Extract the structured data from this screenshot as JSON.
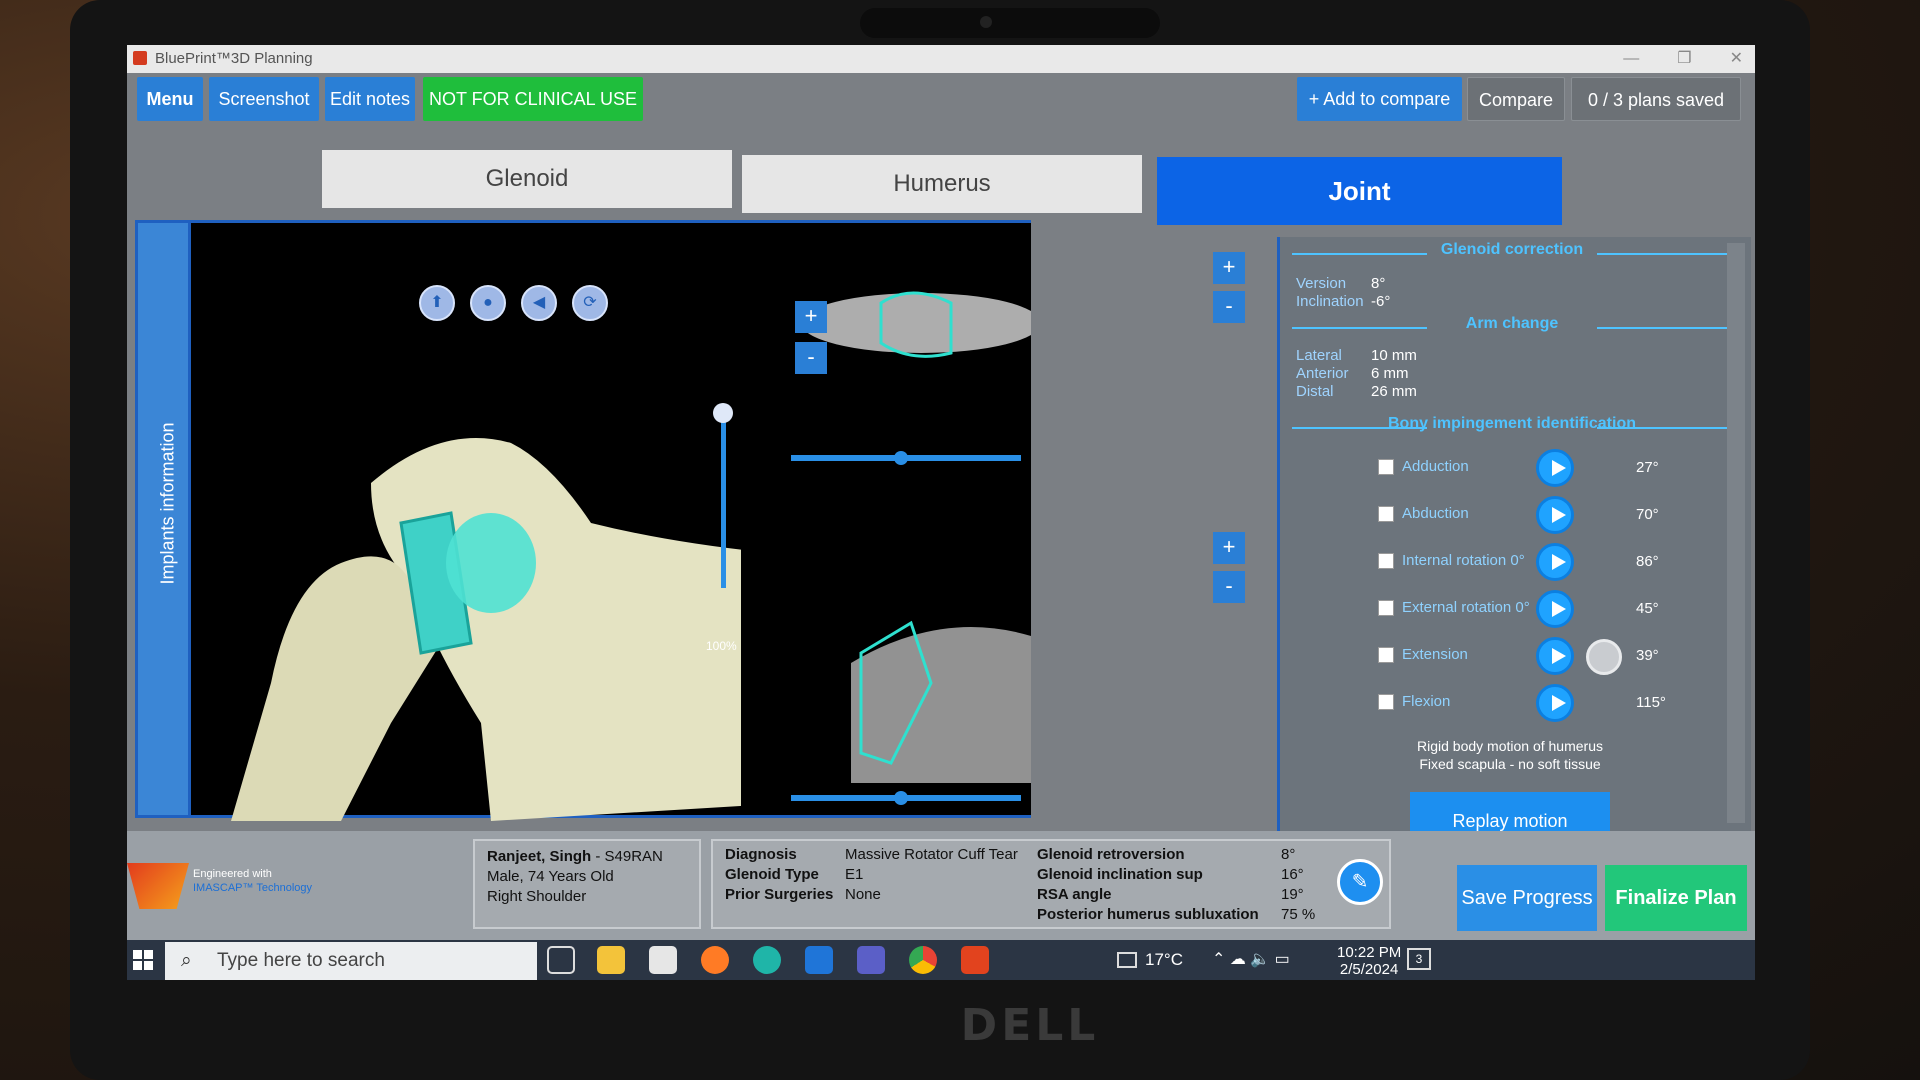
{
  "window": {
    "title": "BluePrint™3D Planning"
  },
  "toolbar": {
    "menu": "Menu",
    "screenshot": "Screenshot",
    "edit_notes": "Edit notes",
    "not_clinical": "NOT FOR CLINICAL USE",
    "add_compare": "+ Add to compare",
    "compare": "Compare",
    "plans_saved": "0 / 3 plans saved"
  },
  "tabs": {
    "glenoid": "Glenoid",
    "humerus": "Humerus",
    "joint": "Joint"
  },
  "sidebar": {
    "implants": "Implants information"
  },
  "view": {
    "zoom": "100%"
  },
  "glenoid_correction": {
    "title": "Glenoid correction",
    "version_label": "Version",
    "version": "8°",
    "inclination_label": "Inclination",
    "inclination": "-6°"
  },
  "arm_change": {
    "title": "Arm change",
    "lateral_label": "Lateral",
    "lateral": "10 mm",
    "anterior_label": "Anterior",
    "anterior": "6 mm",
    "distal_label": "Distal",
    "distal": "26 mm"
  },
  "impingement": {
    "title": "Bony impingement identification",
    "rows": [
      {
        "label": "Adduction",
        "deg": "27°"
      },
      {
        "label": "Abduction",
        "deg": "70°"
      },
      {
        "label": "Internal rotation 0°",
        "deg": "86°"
      },
      {
        "label": "External rotation 0°",
        "deg": "45°"
      },
      {
        "label": "Extension",
        "deg": "39°"
      },
      {
        "label": "Flexion",
        "deg": "115°"
      }
    ],
    "note1": "Rigid body motion of humerus",
    "note2": "Fixed scapula - no soft tissue",
    "replay": "Replay motion"
  },
  "patient": {
    "name": "Ranjeet, Singh",
    "id": "- S49RAN",
    "info": "Male, 74 Years Old",
    "side": "Right Shoulder"
  },
  "clinical": {
    "diagnosis_label": "Diagnosis",
    "diagnosis": "Massive Rotator Cuff Tear",
    "type_label": "Glenoid Type",
    "type": "E1",
    "prior_label": "Prior Surgeries",
    "prior": "None",
    "retro_label": "Glenoid retroversion",
    "retro": "8°",
    "incl_label": "Glenoid inclination sup",
    "incl": "16°",
    "rsa_label": "RSA angle",
    "rsa": "19°",
    "sublux_label": "Posterior humerus subluxation",
    "sublux": "75 %"
  },
  "brand": {
    "line1": "Engineered with",
    "line2": "IMASCAP™ Technology"
  },
  "actions": {
    "save": "Save Progress",
    "finalize": "Finalize Plan"
  },
  "taskbar": {
    "search": "Type here to search",
    "temp": "17°C",
    "time": "10:22 PM",
    "date": "2/5/2024",
    "notif": "3"
  },
  "bezel": {
    "brand": "DELL"
  }
}
